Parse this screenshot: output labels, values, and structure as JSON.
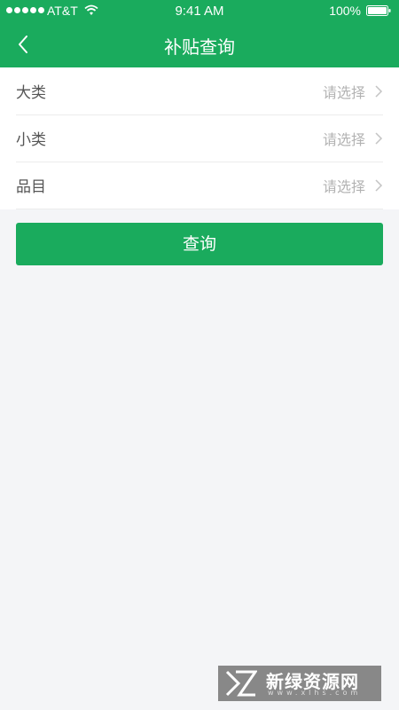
{
  "status_bar": {
    "carrier": "AT&T",
    "time": "9:41 AM",
    "battery": "100%"
  },
  "nav": {
    "title": "补贴查询",
    "back_icon": "chevron-left-icon"
  },
  "form": {
    "rows": [
      {
        "label": "大类",
        "placeholder": "请选择"
      },
      {
        "label": "小类",
        "placeholder": "请选择"
      },
      {
        "label": "品目",
        "placeholder": "请选择"
      }
    ]
  },
  "actions": {
    "query_label": "查询"
  },
  "watermark": {
    "text": "新绿资源网",
    "url": "www.xlhs.com"
  },
  "colors": {
    "brand_green": "#1aab5d",
    "background": "#f4f5f7",
    "placeholder": "#b3b3b3"
  }
}
